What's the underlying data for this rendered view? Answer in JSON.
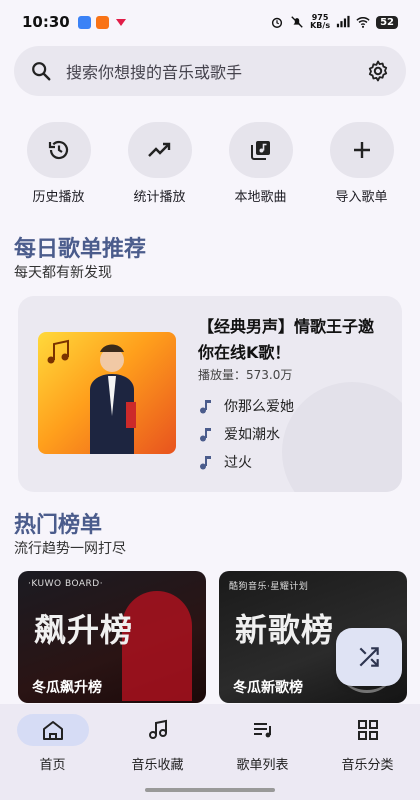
{
  "status": {
    "time": "10:30",
    "net_speed_top": "975",
    "net_speed_bottom": "KB/s",
    "signal": "5G",
    "battery": "52"
  },
  "search": {
    "placeholder": "搜索你想搜的音乐或歌手"
  },
  "quick_actions": [
    {
      "label": "历史播放",
      "icon": "history-icon"
    },
    {
      "label": "统计播放",
      "icon": "trending-icon"
    },
    {
      "label": "本地歌曲",
      "icon": "library-music-icon"
    },
    {
      "label": "导入歌单",
      "icon": "plus-icon"
    }
  ],
  "daily": {
    "title": "每日歌单推荐",
    "subtitle": "每天都有新发现",
    "playlist": {
      "title": "【经典男声】情歌王子邀你在线K歌！",
      "plays": "播放量：573.0万",
      "songs": [
        "你那么爱她",
        "爱如潮水",
        "过火"
      ]
    }
  },
  "hot": {
    "title": "热门榜单",
    "subtitle": "流行趋势一网打尽",
    "charts": [
      {
        "brand": "·KUWO BOARD·",
        "big": "飙升榜",
        "name": "冬瓜飙升榜"
      },
      {
        "brand": "酷狗音乐·星耀计划",
        "big": "新歌榜",
        "name": "冬瓜新歌榜"
      }
    ]
  },
  "nav": [
    {
      "label": "首页",
      "icon": "home-icon",
      "active": true
    },
    {
      "label": "音乐收藏",
      "icon": "music-collection-icon",
      "active": false
    },
    {
      "label": "歌单列表",
      "icon": "playlist-icon",
      "active": false
    },
    {
      "label": "音乐分类",
      "icon": "category-icon",
      "active": false
    }
  ],
  "colors": {
    "accent": "#4b5c8c",
    "background": "#f7f5fb",
    "nav_active": "#d6dcf5"
  }
}
